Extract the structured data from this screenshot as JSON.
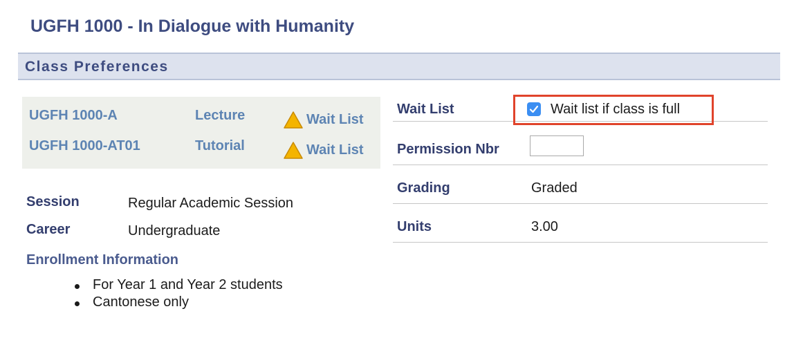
{
  "page": {
    "title": "UGFH 1000 - In Dialogue with Humanity"
  },
  "section": {
    "title": "Class Preferences"
  },
  "components": [
    {
      "id": "UGFH 1000-A",
      "type": "Lecture",
      "status": "Wait List",
      "status_icon": "warning-triangle-icon"
    },
    {
      "id": "UGFH 1000-AT01",
      "type": "Tutorial",
      "status": "Wait List",
      "status_icon": "warning-triangle-icon"
    }
  ],
  "info": {
    "session_label": "Session",
    "session_value": "Regular Academic Session",
    "career_label": "Career",
    "career_value": "Undergraduate"
  },
  "enrollment": {
    "title": "Enrollment Information",
    "items": [
      "For Year 1 and Year 2 students",
      "Cantonese only"
    ]
  },
  "preferences": {
    "wait_list_label": "Wait List",
    "wait_list_checkbox_label": "Wait list if class is full",
    "wait_list_checked": true,
    "permission_label": "Permission Nbr",
    "permission_value": "",
    "grading_label": "Grading",
    "grading_value": "Graded",
    "units_label": "Units",
    "units_value": "3.00"
  },
  "colors": {
    "title": "#3e4c80",
    "link": "#5d84b3",
    "header_bg": "#dde2ee",
    "highlight_border": "#e0432b",
    "checkbox": "#3b8ef2",
    "warning": "#f4b400"
  }
}
